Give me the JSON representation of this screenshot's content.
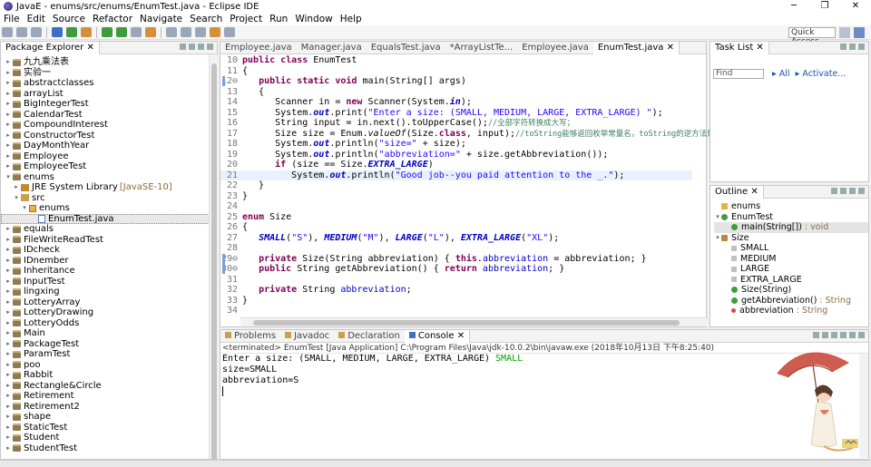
{
  "window": {
    "title": "JavaE - enums/src/enums/EnumTest.java - Eclipse IDE",
    "controls": [
      "─",
      "❐",
      "✕"
    ]
  },
  "menu": [
    "File",
    "Edit",
    "Source",
    "Refactor",
    "Navigate",
    "Search",
    "Project",
    "Run",
    "Window",
    "Help"
  ],
  "toolbar": {
    "quick_access": "Quick Access"
  },
  "package_explorer": {
    "tab": "Package Explorer",
    "items": [
      {
        "label": "九九乘法表",
        "level": 0,
        "type": "project",
        "expanded": false
      },
      {
        "label": "实验一",
        "level": 0,
        "type": "project",
        "expanded": false
      },
      {
        "label": "abstractclasses",
        "level": 0,
        "type": "project",
        "expanded": false
      },
      {
        "label": "arrayList",
        "level": 0,
        "type": "project",
        "expanded": false
      },
      {
        "label": "BigIntegerTest",
        "level": 0,
        "type": "project",
        "expanded": false
      },
      {
        "label": "CalendarTest",
        "level": 0,
        "type": "project",
        "expanded": false
      },
      {
        "label": "CompoundInterest",
        "level": 0,
        "type": "project",
        "expanded": false
      },
      {
        "label": "ConstructorTest",
        "level": 0,
        "type": "project",
        "expanded": false
      },
      {
        "label": "DayMonthYear",
        "level": 0,
        "type": "project",
        "expanded": false
      },
      {
        "label": "Employee",
        "level": 0,
        "type": "project",
        "expanded": false
      },
      {
        "label": "EmployeeTest",
        "level": 0,
        "type": "project",
        "expanded": false
      },
      {
        "label": "enums",
        "level": 0,
        "type": "project",
        "expanded": true
      },
      {
        "label": "JRE System Library",
        "tag": "[JavaSE-10]",
        "level": 1,
        "type": "lib",
        "expanded": false
      },
      {
        "label": "src",
        "level": 1,
        "type": "src",
        "expanded": true
      },
      {
        "label": "enums",
        "level": 2,
        "type": "pkg",
        "expanded": true
      },
      {
        "label": "EnumTest.java",
        "level": 3,
        "type": "java",
        "expanded": false,
        "selected": true
      },
      {
        "label": "equals",
        "level": 0,
        "type": "project",
        "expanded": false
      },
      {
        "label": "FileWriteReadTest",
        "level": 0,
        "type": "project",
        "expanded": false
      },
      {
        "label": "IDcheck",
        "level": 0,
        "type": "project",
        "expanded": false
      },
      {
        "label": "IDnember",
        "level": 0,
        "type": "project",
        "expanded": false
      },
      {
        "label": "Inheritance",
        "level": 0,
        "type": "project",
        "expanded": false
      },
      {
        "label": "InputTest",
        "level": 0,
        "type": "project",
        "expanded": false
      },
      {
        "label": "lingxing",
        "level": 0,
        "type": "project",
        "expanded": false
      },
      {
        "label": "LotteryArray",
        "level": 0,
        "type": "project",
        "expanded": false
      },
      {
        "label": "LotteryDrawing",
        "level": 0,
        "type": "project",
        "expanded": false
      },
      {
        "label": "LotteryOdds",
        "level": 0,
        "type": "project",
        "expanded": false
      },
      {
        "label": "Main",
        "level": 0,
        "type": "project",
        "expanded": false
      },
      {
        "label": "PackageTest",
        "level": 0,
        "type": "project",
        "expanded": false
      },
      {
        "label": "ParamTest",
        "level": 0,
        "type": "project",
        "expanded": false
      },
      {
        "label": "poo",
        "level": 0,
        "type": "project",
        "expanded": false
      },
      {
        "label": "Rabbit",
        "level": 0,
        "type": "project",
        "expanded": false
      },
      {
        "label": "Rectangle&Circle",
        "level": 0,
        "type": "project",
        "expanded": false
      },
      {
        "label": "Retirement",
        "level": 0,
        "type": "project",
        "expanded": false
      },
      {
        "label": "Retirement2",
        "level": 0,
        "type": "project",
        "expanded": false
      },
      {
        "label": "shape",
        "level": 0,
        "type": "project",
        "expanded": false
      },
      {
        "label": "StaticTest",
        "level": 0,
        "type": "project",
        "expanded": false
      },
      {
        "label": "Student",
        "level": 0,
        "type": "project",
        "expanded": false
      },
      {
        "label": "StudentTest",
        "level": 0,
        "type": "project",
        "expanded": false
      }
    ]
  },
  "editor": {
    "tabs": [
      {
        "label": "Employee.java",
        "active": false
      },
      {
        "label": "Manager.java",
        "active": false
      },
      {
        "label": "EqualsTest.java",
        "active": false
      },
      {
        "label": "*ArrayListTe...",
        "active": false
      },
      {
        "label": "Employee.java",
        "active": false
      },
      {
        "label": "EnumTest.java",
        "active": true
      }
    ],
    "lines": [
      {
        "n": "10",
        "html": "<span class=\"kw\">public class</span> EnumTest"
      },
      {
        "n": "11",
        "html": "{"
      },
      {
        "n": "12⊖",
        "html": "   <span class=\"kw\">public static void</span> main(String[] args)"
      },
      {
        "n": "13",
        "html": "   {"
      },
      {
        "n": "14",
        "html": "      Scanner in = <span class=\"kw\">new</span> Scanner(System.<span class=\"fld\">in</span>);"
      },
      {
        "n": "15",
        "html": "      System.<span class=\"fld\">out</span>.print(<span class=\"str\">\"Enter a size: (SMALL, MEDIUM, LARGE, EXTRA_LARGE) \"</span>);"
      },
      {
        "n": "16",
        "html": "      String input = in.next().toUpperCase();<span class=\"cm\">//全部字符转换成大写；</span>"
      },
      {
        "n": "17",
        "html": "      Size size = Enum.<span class=\"st\">valueOf</span>(Size.<span class=\"kw\">class</span>, input);<span class=\"cm\">//toString能够返回枚举常量名，toString的逆方法是静</span>"
      },
      {
        "n": "18",
        "html": "      System.<span class=\"fld\">out</span>.println(<span class=\"str\">\"size=\"</span> + size);"
      },
      {
        "n": "19",
        "html": "      System.<span class=\"fld\">out</span>.println(<span class=\"str\">\"abbreviation=\"</span> + size.getAbbreviation());"
      },
      {
        "n": "20",
        "html": "      <span class=\"kw\">if</span> (size == Size.<span class=\"fld\">EXTRA_LARGE</span>)"
      },
      {
        "n": "21",
        "html": "         System.<span class=\"fld\">out</span>.println(<span class=\"str\">\"Good job--you paid attention to the _.\"</span>);",
        "highlight": true
      },
      {
        "n": "22",
        "html": "   }"
      },
      {
        "n": "23",
        "html": "}"
      },
      {
        "n": "24",
        "html": ""
      },
      {
        "n": "25",
        "html": "<span class=\"kw\">enum</span> Size"
      },
      {
        "n": "26",
        "html": "{"
      },
      {
        "n": "27",
        "html": "   <span class=\"fld\">SMALL</span>(<span class=\"str\">\"S\"</span>), <span class=\"fld\">MEDIUM</span>(<span class=\"str\">\"M\"</span>), <span class=\"fld\">LARGE</span>(<span class=\"str\">\"L\"</span>), <span class=\"fld\">EXTRA_LARGE</span>(<span class=\"str\">\"XL\"</span>);"
      },
      {
        "n": "28",
        "html": ""
      },
      {
        "n": "29⊖",
        "html": "   <span class=\"kw\">private</span> Size(String abbreviation) { <span class=\"kw\">this</span>.<span class=\"fieldplain\">abbreviation</span> = abbreviation; }"
      },
      {
        "n": "30⊖",
        "html": "   <span class=\"kw\">public</span> String getAbbreviation() { <span class=\"kw\">return</span> <span class=\"fieldplain\">abbreviation</span>; }"
      },
      {
        "n": "31",
        "html": ""
      },
      {
        "n": "32",
        "html": "   <span class=\"kw\">private</span> String <span class=\"fieldplain\">abbreviation</span>;"
      },
      {
        "n": "33",
        "html": "}"
      },
      {
        "n": "34",
        "html": ""
      }
    ]
  },
  "task_list": {
    "tab": "Task List",
    "find_placeholder": "Find",
    "links": [
      "All",
      "Activate..."
    ]
  },
  "outline": {
    "tab": "Outline",
    "items": [
      {
        "label": "enums",
        "icon": "pkg",
        "level": 0
      },
      {
        "label": "EnumTest",
        "icon": "cls",
        "level": 0,
        "twisty": "▾"
      },
      {
        "label": "main(String[]) : void",
        "icon": "mth",
        "level": 1,
        "selected": true
      },
      {
        "label": "Size",
        "icon": "enm",
        "level": 0,
        "twisty": "▾"
      },
      {
        "label": "SMALL",
        "icon": "fld",
        "level": 1
      },
      {
        "label": "MEDIUM",
        "icon": "fld",
        "level": 1
      },
      {
        "label": "LARGE",
        "icon": "fld",
        "level": 1
      },
      {
        "label": "EXTRA_LARGE",
        "icon": "fld",
        "level": 1
      },
      {
        "label": "Size(String)",
        "icon": "mth",
        "level": 1
      },
      {
        "label": "getAbbreviation() : String",
        "icon": "mth",
        "level": 1
      },
      {
        "label": "abbreviation : String",
        "icon": "pfld",
        "level": 1
      }
    ]
  },
  "console": {
    "tabs": [
      {
        "label": "Problems",
        "active": false
      },
      {
        "label": "Javadoc",
        "active": false
      },
      {
        "label": "Declaration",
        "active": false
      },
      {
        "label": "Console",
        "active": true
      }
    ],
    "header": "<terminated> EnumTest [Java Application] C:\\Program Files\\Java\\jdk-10.0.2\\bin\\javaw.exe (2018年10月13日 下午8:25:40)",
    "prompt": "Enter a size: (SMALL, MEDIUM, LARGE, EXTRA_LARGE) ",
    "input": "SMALL",
    "output": [
      "size=SMALL",
      "abbreviation=S"
    ]
  },
  "colors": {
    "keyword": "#7f0055",
    "string": "#2a00ff",
    "field": "#0000c0",
    "comment": "#3f7f5f",
    "console_input": "#00a000",
    "current_line": "#e8f2fe"
  }
}
